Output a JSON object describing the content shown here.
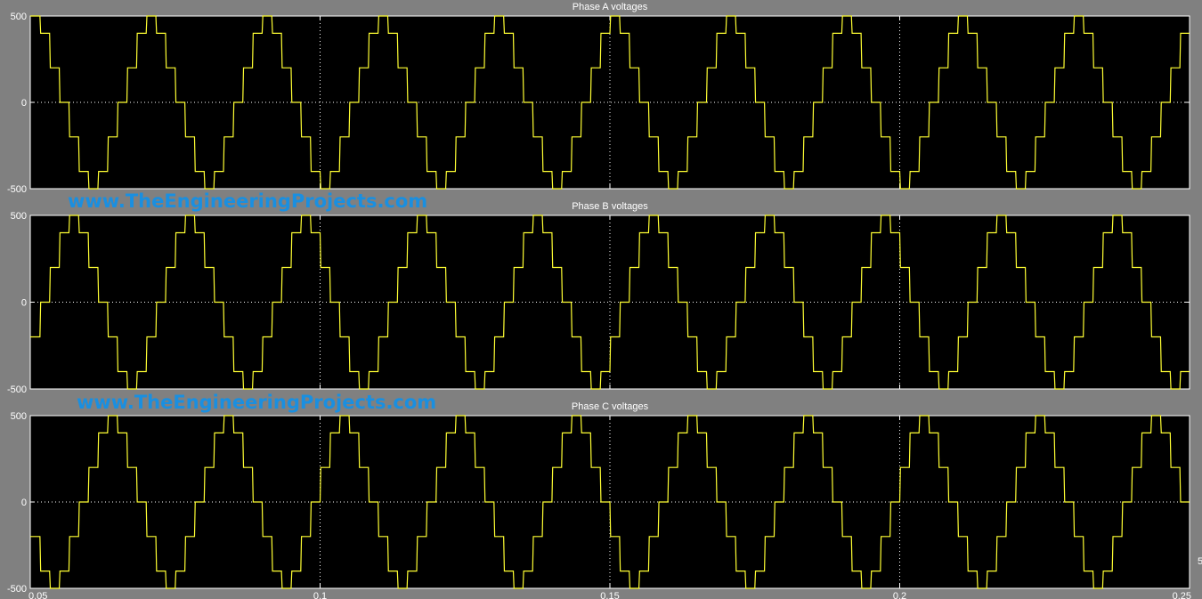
{
  "chart_data": [
    {
      "type": "line",
      "title": "Phase A voltages",
      "xlim": [
        0.05,
        0.25
      ],
      "ylim": [
        -500,
        500
      ],
      "y_ticks": [
        "500",
        "0",
        "-500"
      ],
      "x_ticks": [],
      "grid": true,
      "line_color": "#ffff33",
      "series": [
        {
          "waveform": "six-step stairs",
          "levels": [
            500,
            400,
            200,
            0,
            -200,
            -400,
            -500,
            -400,
            -200,
            0,
            200,
            400
          ],
          "period": 0.02,
          "phase_shift_deg": 0,
          "x_start": 0.05,
          "x_end": 0.25
        }
      ],
      "watermark": "www.TheEngineeringProjects.com"
    },
    {
      "type": "line",
      "title": "Phase B voltages",
      "xlim": [
        0.05,
        0.25
      ],
      "ylim": [
        -500,
        500
      ],
      "y_ticks": [
        "500",
        "0",
        "-500"
      ],
      "x_ticks": [],
      "grid": true,
      "line_color": "#ffff33",
      "series": [
        {
          "waveform": "six-step stairs",
          "levels": [
            500,
            400,
            200,
            0,
            -200,
            -400,
            -500,
            -400,
            -200,
            0,
            200,
            400
          ],
          "period": 0.02,
          "phase_shift_deg": 120,
          "x_start": 0.05,
          "x_end": 0.25
        }
      ],
      "watermark": "www.TheEngineeringProjects.com"
    },
    {
      "type": "line",
      "title": "Phase C voltages",
      "xlim": [
        0.05,
        0.25
      ],
      "ylim": [
        -500,
        500
      ],
      "y_ticks": [
        "500",
        "0",
        "-500"
      ],
      "x_ticks": [
        "0.05",
        "0.1",
        "0.15",
        "0.2",
        "0.25"
      ],
      "grid": true,
      "line_color": "#ffff33",
      "series": [
        {
          "waveform": "six-step stairs",
          "levels": [
            500,
            400,
            200,
            0,
            -200,
            -400,
            -500,
            -400,
            -200,
            0,
            200,
            400
          ],
          "period": 0.02,
          "phase_shift_deg": 240,
          "x_start": 0.05,
          "x_end": 0.25
        }
      ]
    }
  ],
  "axis_edge_label": "5"
}
